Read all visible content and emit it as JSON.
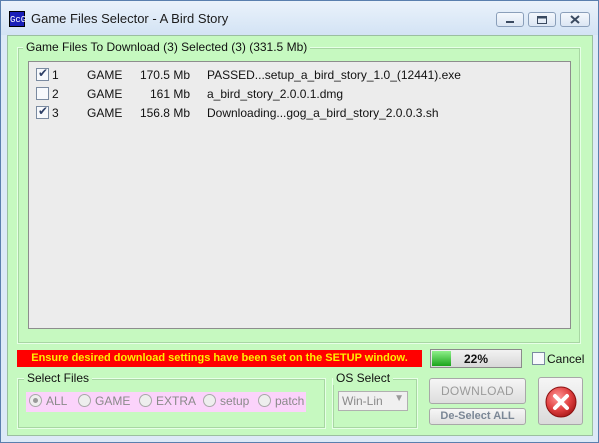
{
  "window": {
    "icon_text": "GcG",
    "title": "Game Files Selector - A Bird Story"
  },
  "files_group": {
    "label": "Game Files To Download (3)  Selected  (3)  (331.5 Mb)"
  },
  "files": [
    {
      "checked": true,
      "num": "1",
      "type": "GAME",
      "size": "170.5 Mb",
      "name": "PASSED...setup_a_bird_story_1.0_(12441).exe"
    },
    {
      "checked": false,
      "num": "2",
      "type": "GAME",
      "size": "161 Mb",
      "name": "a_bird_story_2.0.0.1.dmg"
    },
    {
      "checked": true,
      "num": "3",
      "type": "GAME",
      "size": "156.8 Mb",
      "name": "Downloading...gog_a_bird_story_2.0.0.3.sh"
    }
  ],
  "warning_text": "Ensure desired download settings have been set on the SETUP window.",
  "progress": {
    "percent_label": "22%",
    "fraction": 0.22
  },
  "cancel": {
    "label": "Cancel",
    "checked": false
  },
  "select_files": {
    "label": "Select Files",
    "options": [
      "ALL",
      "GAME",
      "EXTRA",
      "setup",
      "patch"
    ],
    "selected": "ALL"
  },
  "os_select": {
    "label": "OS Select",
    "value": "Win-Lin"
  },
  "buttons": {
    "download": "DOWNLOAD",
    "deselect_all": "De-Select ALL"
  },
  "colors": {
    "background": "#c6f9c0",
    "warning_bg": "#ff0000",
    "warning_text": "#ffee00",
    "radio_strip": "#fbd3fb",
    "progress_fill": "#1aa51a",
    "exit_icon": "#e04040"
  }
}
